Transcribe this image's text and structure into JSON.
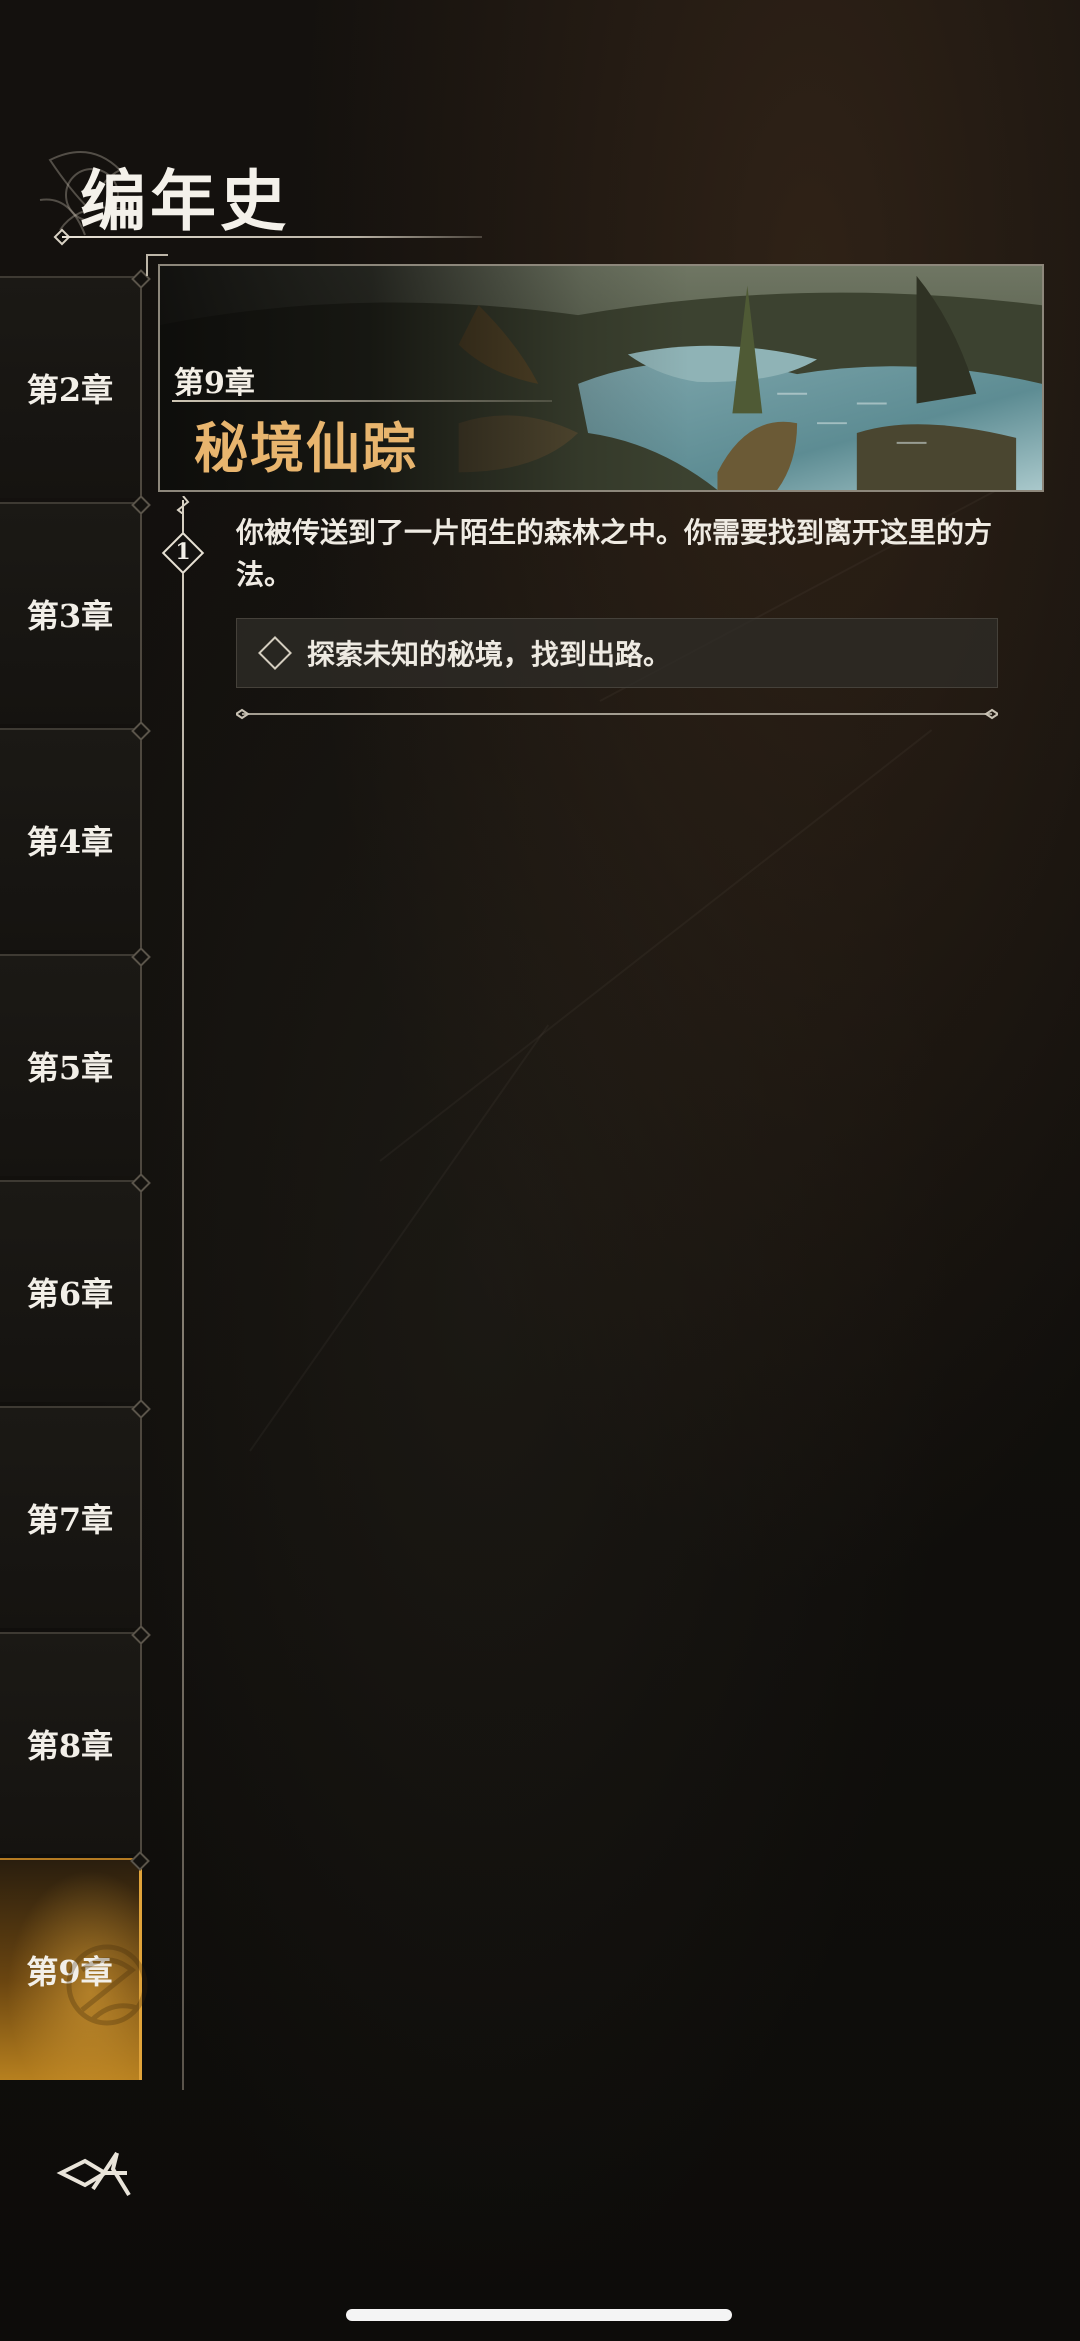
{
  "header": {
    "title": "编年史"
  },
  "chapters": [
    {
      "label": "第2章",
      "active": false
    },
    {
      "label": "第3章",
      "active": false
    },
    {
      "label": "第4章",
      "active": false
    },
    {
      "label": "第5章",
      "active": false
    },
    {
      "label": "第6章",
      "active": false
    },
    {
      "label": "第7章",
      "active": false
    },
    {
      "label": "第8章",
      "active": false
    },
    {
      "label": "第9章",
      "active": true
    }
  ],
  "banner": {
    "chapter_label": "第9章",
    "chapter_name": "秘境仙踪"
  },
  "quest": {
    "step_number": "1",
    "description": "你被传送到了一片陌生的森林之中。你需要找到离开这里的方法。",
    "objective": "探索未知的秘境，找到出路。"
  },
  "colors": {
    "accent_gold": "#e8b56e",
    "active_tab": "#b7801f"
  },
  "icons": {
    "back": "back-arrow-icon",
    "objective": "diamond-icon"
  }
}
